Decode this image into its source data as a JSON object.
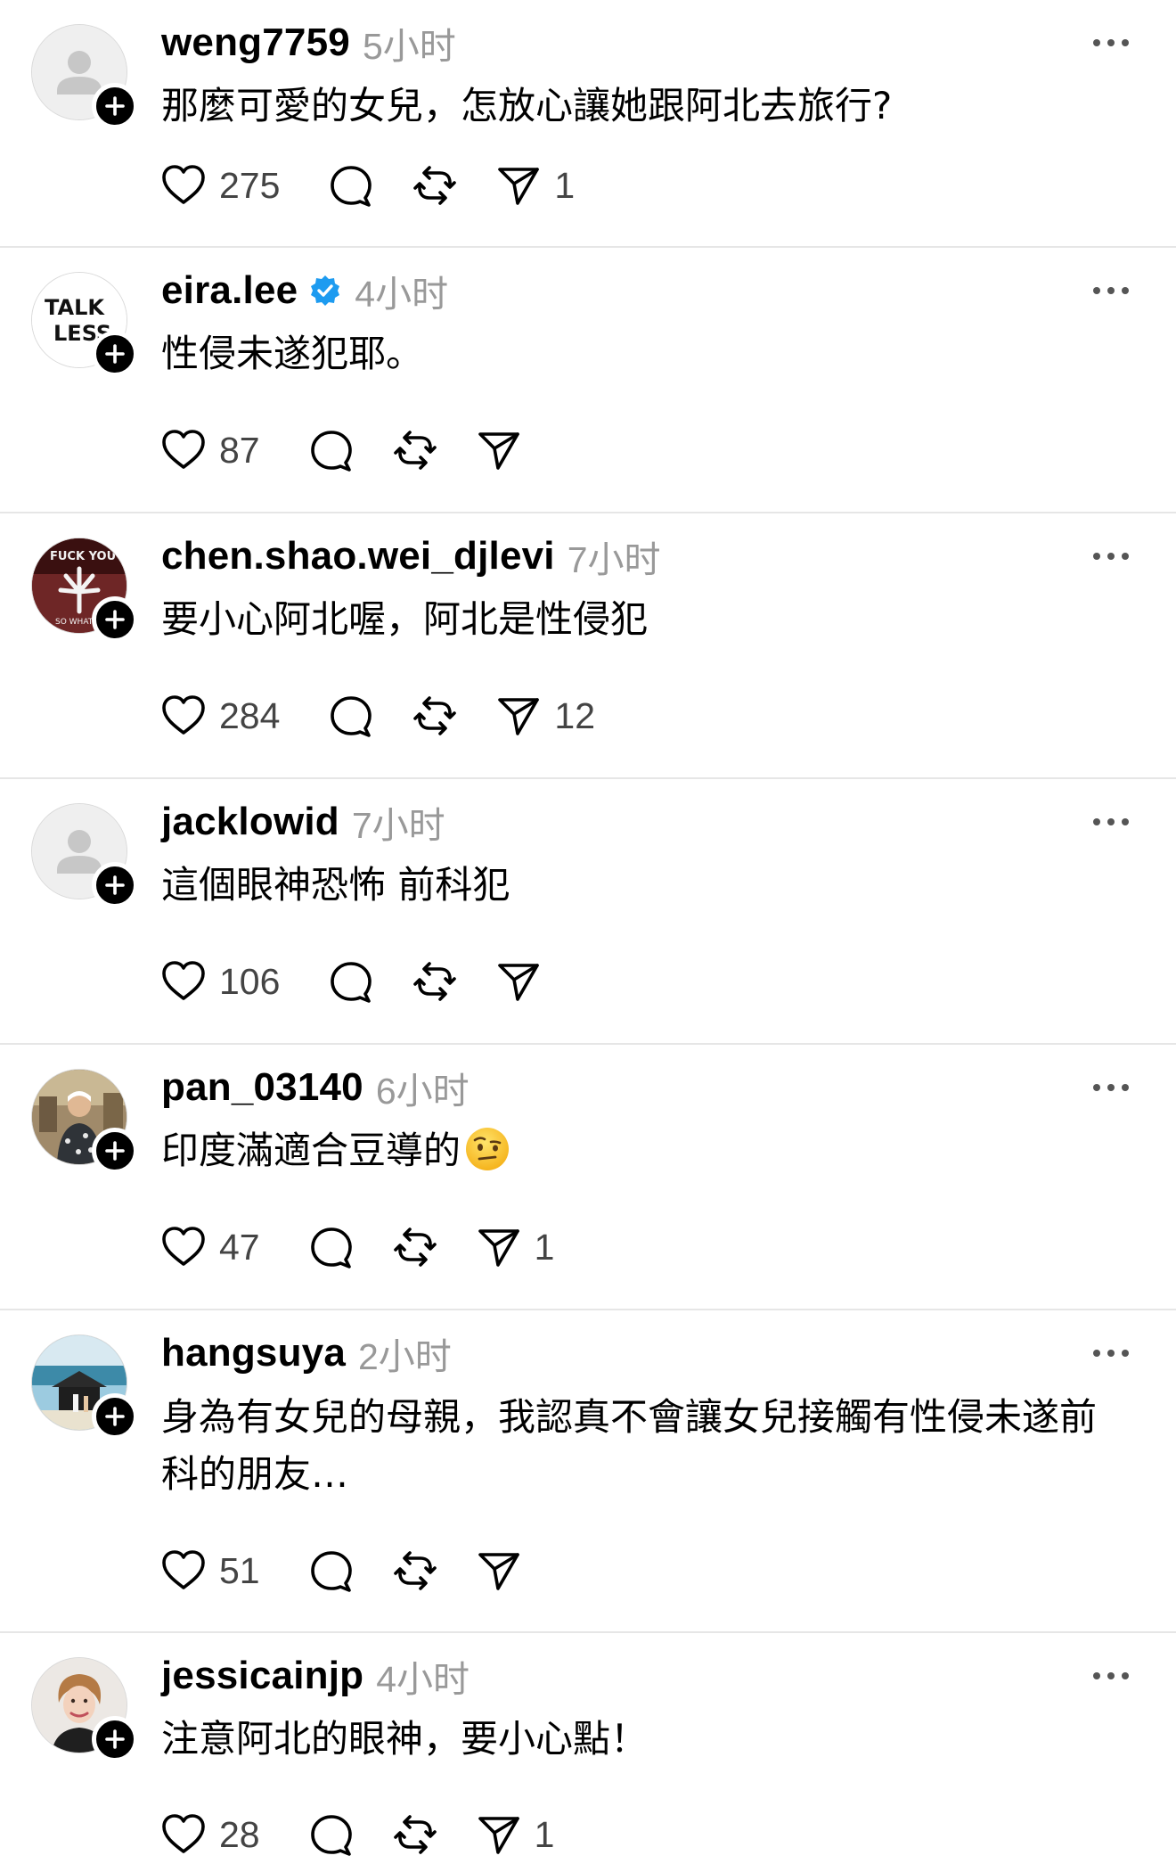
{
  "colors": {
    "username": "#000000",
    "timestamp": "#999999",
    "count": "#444444",
    "divider": "#e6e6e6",
    "verified": "#1d9bf0",
    "badge": "#000000"
  },
  "posts": [
    {
      "username": "weng7759",
      "time": "5小时",
      "text": "那麼可愛的女兒，怎放心讓她跟阿北去旅行?",
      "likes": "275",
      "shares": "1",
      "verified": false,
      "avatar": "default-avatar"
    },
    {
      "username": "eira.lee",
      "time": "4小时",
      "text": "性侵未遂犯耶。",
      "likes": "87",
      "shares": "",
      "verified": true,
      "avatar": "talk-less-avatar",
      "avatar_text": [
        "TALK",
        "LESS"
      ]
    },
    {
      "username": "chen.shao.wei_djlevi",
      "time": "7小时",
      "text": "要小心阿北喔，阿北是性侵犯",
      "likes": "284",
      "shares": "12",
      "verified": false,
      "avatar": "cannabis-avatar",
      "avatar_text": [
        "FUCK YOU",
        "SO WHAT"
      ]
    },
    {
      "username": "jacklowid",
      "time": "7小时",
      "text": "這個眼神恐怖 前科犯",
      "likes": "106",
      "shares": "",
      "verified": false,
      "avatar": "default-avatar"
    },
    {
      "username": "pan_03140",
      "time": "6小时",
      "text": "印度滿適合豆導的",
      "likes": "47",
      "shares": "1",
      "verified": false,
      "avatar": "photo-avatar",
      "emoji": "raised-eyebrow-emoji"
    },
    {
      "username": "hangsuya",
      "time": "2小时",
      "text": "身為有女兒的母親，我認真不會讓女兒接觸有性侵未遂前科的朋友…",
      "likes": "51",
      "shares": "",
      "verified": false,
      "avatar": "beach-avatar"
    },
    {
      "username": "jessicainjp",
      "time": "4小时",
      "text": "注意阿北的眼神，要小心點！",
      "likes": "28",
      "shares": "1",
      "verified": false,
      "avatar": "portrait-avatar"
    }
  ]
}
